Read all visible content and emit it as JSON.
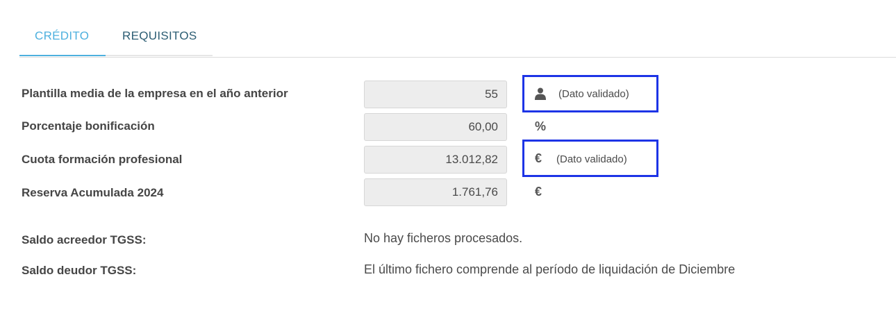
{
  "tabs": [
    {
      "label": "CRÉDITO",
      "active": true
    },
    {
      "label": "REQUISITOS",
      "active": false
    }
  ],
  "rows": [
    {
      "label": "Plantilla media de la empresa en el año anterior",
      "value": "55",
      "icon": "person-icon",
      "validated": "(Dato validado)"
    },
    {
      "label": "Porcentaje bonificación",
      "value": "60,00",
      "unit": "%"
    },
    {
      "label": "Cuota formación profesional",
      "value": "13.012,82",
      "unit": "€",
      "validated": "(Dato validado)"
    },
    {
      "label": "Reserva Acumulada 2024",
      "value": "1.761,76",
      "unit": "€"
    }
  ],
  "saldo": [
    {
      "label": "Saldo acreedor TGSS:",
      "text": "No hay ficheros procesados."
    },
    {
      "label": "Saldo deudor TGSS:",
      "text": "El último fichero comprende al período de liquidación de Diciembre"
    }
  ],
  "colors": {
    "accent": "#4db0de",
    "highlight": "#1d34e6"
  }
}
